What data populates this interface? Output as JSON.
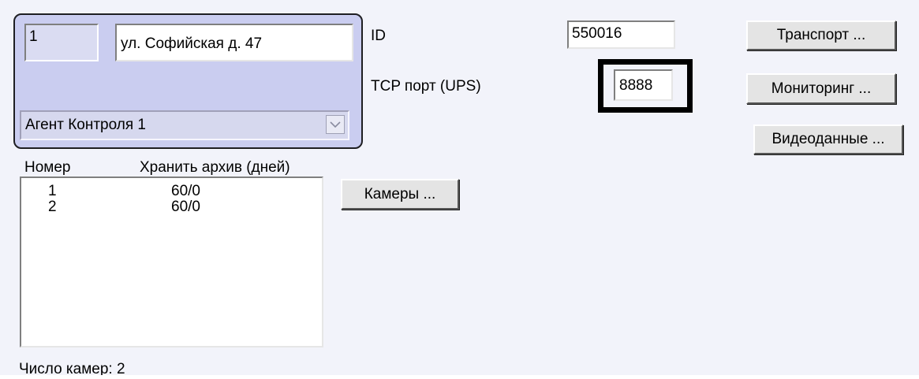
{
  "group": {
    "number": "1",
    "address": "ул. Софийская д. 47",
    "agent_select": "Агент Контроля 1"
  },
  "id_label": "ID",
  "id_value": "550016",
  "tcp_port_label": "TCP порт (UPS)",
  "tcp_port_value": "8888",
  "buttons": {
    "transport": "Транспорт ...",
    "monitoring": "Мониторинг ...",
    "video": "Видеоданные ...",
    "cameras": "Камеры ..."
  },
  "cameras_table": {
    "columns": [
      "Номер",
      "Хранить архив (дней)"
    ],
    "rows": [
      {
        "number": "1",
        "archive": "60/0"
      },
      {
        "number": "2",
        "archive": "60/0"
      }
    ]
  },
  "camera_count": "Число камер: 2",
  "colors": {
    "panel_bg": "#f2f3fa",
    "group_bg": "#cacdf0",
    "highlight_border": "#000000"
  },
  "icons": {
    "select_arrow": "chevron-down-icon"
  }
}
